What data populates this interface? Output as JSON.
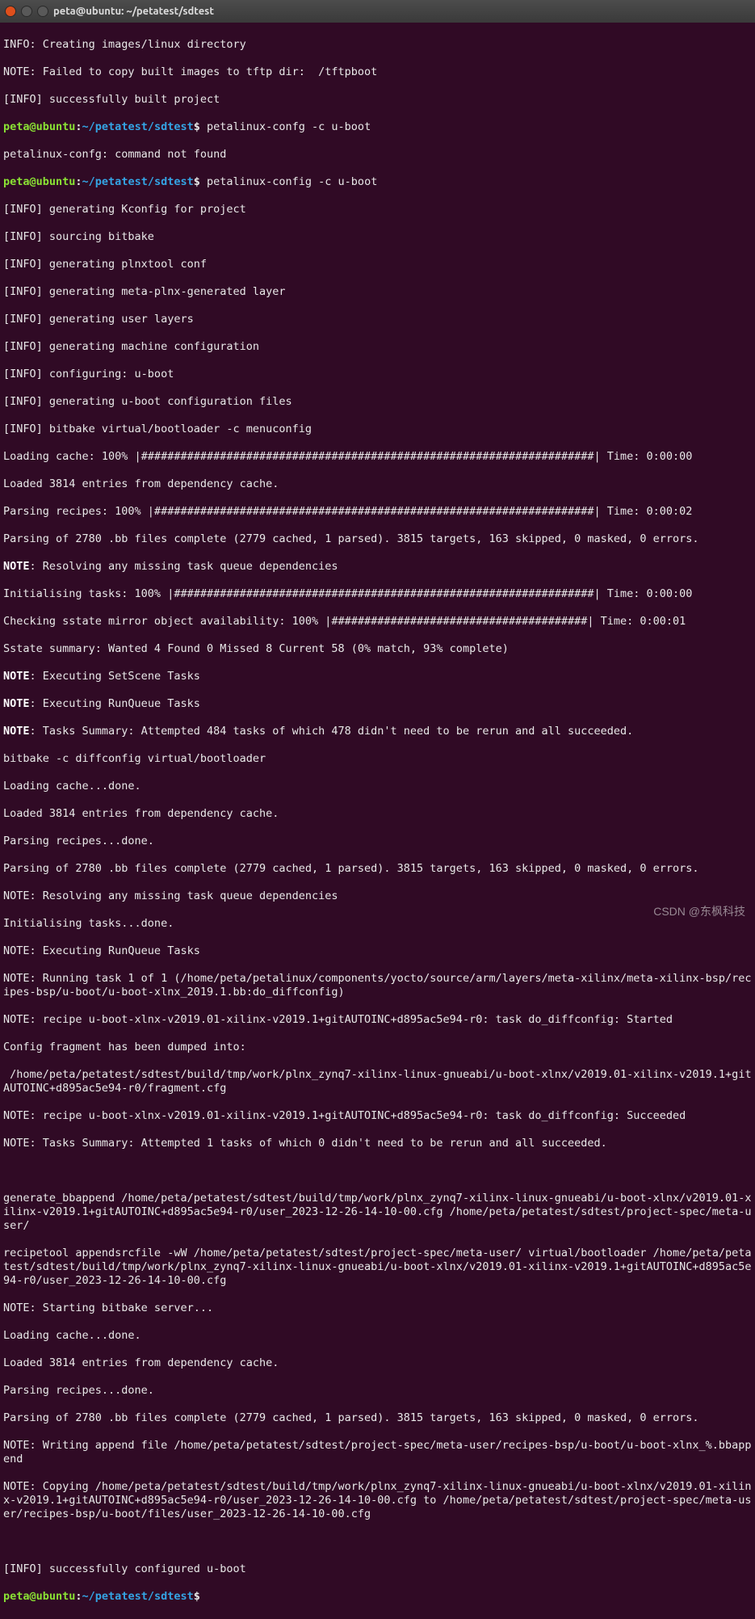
{
  "window": {
    "title": "peta@ubuntu: ~/petatest/sdtest"
  },
  "prompt": {
    "user_host": "peta@ubuntu",
    "sep": ":",
    "path": "~/petatest/sdtest",
    "sigil": "$"
  },
  "cmd1": "petalinux-confg -c u-boot",
  "cmd2": "petalinux-config -c u-boot",
  "lines": {
    "l01": "INFO: Creating images/linux directory",
    "l02": "NOTE: Failed to copy built images to tftp dir:  /tftpboot",
    "l03": "[INFO] successfully built project",
    "l04": "petalinux-confg: command not found",
    "l05": "[INFO] generating Kconfig for project",
    "l06": "[INFO] sourcing bitbake",
    "l07": "[INFO] generating plnxtool conf",
    "l08": "[INFO] generating meta-plnx-generated layer",
    "l09": "[INFO] generating user layers",
    "l10": "[INFO] generating machine configuration",
    "l11": "[INFO] configuring: u-boot",
    "l12": "[INFO] generating u-boot configuration files",
    "l13": "[INFO] bitbake virtual/bootloader -c menuconfig",
    "l14": "Loading cache: 100% |#####################################################################| Time: 0:00:00",
    "l15": "Loaded 3814 entries from dependency cache.",
    "l16": "Parsing recipes: 100% |###################################################################| Time: 0:00:02",
    "l17": "Parsing of 2780 .bb files complete (2779 cached, 1 parsed). 3815 targets, 163 skipped, 0 masked, 0 errors.",
    "l18a": "NOTE",
    "l18b": ": Resolving any missing task queue dependencies",
    "l19": "Initialising tasks: 100% |################################################################| Time: 0:00:00",
    "l20": "Checking sstate mirror object availability: 100% |#######################################| Time: 0:00:01",
    "l21": "Sstate summary: Wanted 4 Found 0 Missed 8 Current 58 (0% match, 93% complete)",
    "l22a": "NOTE",
    "l22b": ": Executing SetScene Tasks",
    "l23a": "NOTE",
    "l23b": ": Executing RunQueue Tasks",
    "l24a": "NOTE",
    "l24b": ": Tasks Summary: Attempted 484 tasks of which 478 didn't need to be rerun and all succeeded.",
    "l25": "bitbake -c diffconfig virtual/bootloader",
    "l26": "Loading cache...done.",
    "l27": "Loaded 3814 entries from dependency cache.",
    "l28": "Parsing recipes...done.",
    "l29": "Parsing of 2780 .bb files complete (2779 cached, 1 parsed). 3815 targets, 163 skipped, 0 masked, 0 errors.",
    "l30": "NOTE: Resolving any missing task queue dependencies",
    "l31": "Initialising tasks...done.",
    "l32": "NOTE: Executing RunQueue Tasks",
    "l33": "NOTE: Running task 1 of 1 (/home/peta/petalinux/components/yocto/source/arm/layers/meta-xilinx/meta-xilinx-bsp/recipes-bsp/u-boot/u-boot-xlnx_2019.1.bb:do_diffconfig)",
    "l34": "NOTE: recipe u-boot-xlnx-v2019.01-xilinx-v2019.1+gitAUTOINC+d895ac5e94-r0: task do_diffconfig: Started",
    "l35": "Config fragment has been dumped into:",
    "l36": " /home/peta/petatest/sdtest/build/tmp/work/plnx_zynq7-xilinx-linux-gnueabi/u-boot-xlnx/v2019.01-xilinx-v2019.1+gitAUTOINC+d895ac5e94-r0/fragment.cfg",
    "l37": "NOTE: recipe u-boot-xlnx-v2019.01-xilinx-v2019.1+gitAUTOINC+d895ac5e94-r0: task do_diffconfig: Succeeded",
    "l38": "NOTE: Tasks Summary: Attempted 1 tasks of which 0 didn't need to be rerun and all succeeded.",
    "l39": "",
    "l40": "generate_bbappend /home/peta/petatest/sdtest/build/tmp/work/plnx_zynq7-xilinx-linux-gnueabi/u-boot-xlnx/v2019.01-xilinx-v2019.1+gitAUTOINC+d895ac5e94-r0/user_2023-12-26-14-10-00.cfg /home/peta/petatest/sdtest/project-spec/meta-user/",
    "l41": "recipetool appendsrcfile -wW /home/peta/petatest/sdtest/project-spec/meta-user/ virtual/bootloader /home/peta/petatest/sdtest/build/tmp/work/plnx_zynq7-xilinx-linux-gnueabi/u-boot-xlnx/v2019.01-xilinx-v2019.1+gitAUTOINC+d895ac5e94-r0/user_2023-12-26-14-10-00.cfg",
    "l42": "NOTE: Starting bitbake server...",
    "l43": "Loading cache...done.",
    "l44": "Loaded 3814 entries from dependency cache.",
    "l45": "Parsing recipes...done.",
    "l46": "Parsing of 2780 .bb files complete (2779 cached, 1 parsed). 3815 targets, 163 skipped, 0 masked, 0 errors.",
    "l47": "NOTE: Writing append file /home/peta/petatest/sdtest/project-spec/meta-user/recipes-bsp/u-boot/u-boot-xlnx_%.bbappend",
    "l48": "NOTE: Copying /home/peta/petatest/sdtest/build/tmp/work/plnx_zynq7-xilinx-linux-gnueabi/u-boot-xlnx/v2019.01-xilinx-v2019.1+gitAUTOINC+d895ac5e94-r0/user_2023-12-26-14-10-00.cfg to /home/peta/petatest/sdtest/project-spec/meta-user/recipes-bsp/u-boot/files/user_2023-12-26-14-10-00.cfg",
    "l49": "",
    "l50": "[INFO] successfully configured u-boot"
  },
  "watermark": "CSDN @东枫科技"
}
